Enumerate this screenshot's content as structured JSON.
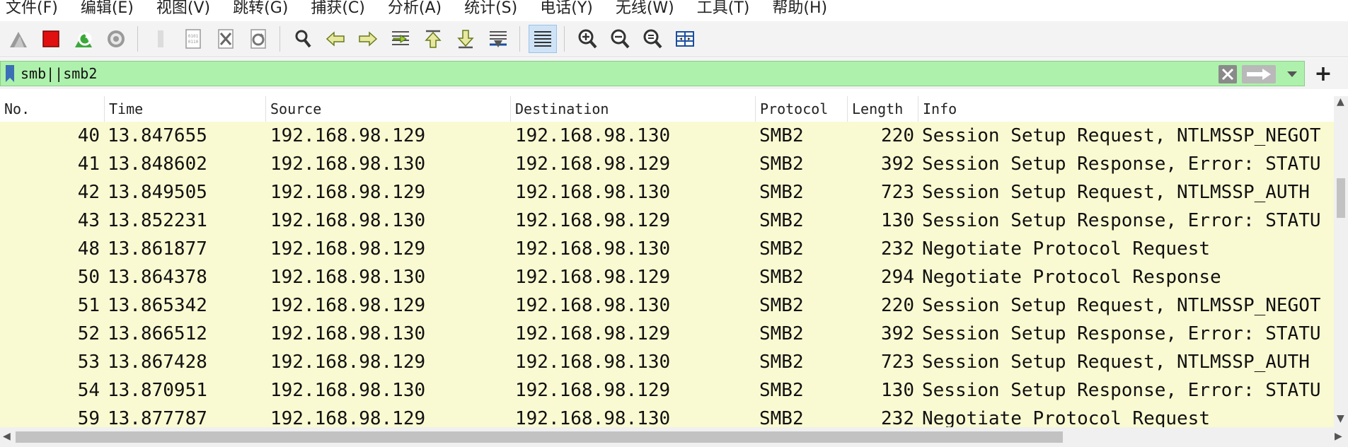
{
  "menu": [
    "文件(F)",
    "编辑(E)",
    "视图(V)",
    "跳转(G)",
    "捕获(C)",
    "分析(A)",
    "统计(S)",
    "电话(Y)",
    "无线(W)",
    "工具(T)",
    "帮助(H)"
  ],
  "toolbar_icons": [
    "shark-fin-start-icon",
    "stop-capture-icon",
    "restart-capture-icon",
    "capture-options-icon",
    "open-file-icon",
    "binary-file-icon",
    "close-file-icon",
    "reload-file-icon",
    "find-packet-icon",
    "go-back-icon",
    "go-forward-icon",
    "go-to-packet-icon",
    "first-packet-icon",
    "last-packet-icon",
    "autoscroll-icon",
    "colorize-icon",
    "zoom-in-icon",
    "zoom-out-icon",
    "normal-size-icon",
    "resize-columns-icon"
  ],
  "filter": {
    "text": "smb||smb2"
  },
  "columns": {
    "no": "No.",
    "time": "Time",
    "source": "Source",
    "destination": "Destination",
    "protocol": "Protocol",
    "length": "Length",
    "info": "Info"
  },
  "packets": [
    {
      "no": "40",
      "time": "13.847655",
      "source": "192.168.98.129",
      "destination": "192.168.98.130",
      "protocol": "SMB2",
      "length": "220",
      "info": "Session Setup Request, NTLMSSP_NEGOT"
    },
    {
      "no": "41",
      "time": "13.848602",
      "source": "192.168.98.130",
      "destination": "192.168.98.129",
      "protocol": "SMB2",
      "length": "392",
      "info": "Session Setup Response, Error: STATU"
    },
    {
      "no": "42",
      "time": "13.849505",
      "source": "192.168.98.129",
      "destination": "192.168.98.130",
      "protocol": "SMB2",
      "length": "723",
      "info": "Session Setup Request, NTLMSSP_AUTH"
    },
    {
      "no": "43",
      "time": "13.852231",
      "source": "192.168.98.130",
      "destination": "192.168.98.129",
      "protocol": "SMB2",
      "length": "130",
      "info": "Session Setup Response, Error: STATU"
    },
    {
      "no": "48",
      "time": "13.861877",
      "source": "192.168.98.129",
      "destination": "192.168.98.130",
      "protocol": "SMB2",
      "length": "232",
      "info": "Negotiate Protocol Request"
    },
    {
      "no": "50",
      "time": "13.864378",
      "source": "192.168.98.130",
      "destination": "192.168.98.129",
      "protocol": "SMB2",
      "length": "294",
      "info": "Negotiate Protocol Response"
    },
    {
      "no": "51",
      "time": "13.865342",
      "source": "192.168.98.129",
      "destination": "192.168.98.130",
      "protocol": "SMB2",
      "length": "220",
      "info": "Session Setup Request, NTLMSSP_NEGOT"
    },
    {
      "no": "52",
      "time": "13.866512",
      "source": "192.168.98.130",
      "destination": "192.168.98.129",
      "protocol": "SMB2",
      "length": "392",
      "info": "Session Setup Response, Error: STATU"
    },
    {
      "no": "53",
      "time": "13.867428",
      "source": "192.168.98.129",
      "destination": "192.168.98.130",
      "protocol": "SMB2",
      "length": "723",
      "info": "Session Setup Request, NTLMSSP_AUTH"
    },
    {
      "no": "54",
      "time": "13.870951",
      "source": "192.168.98.130",
      "destination": "192.168.98.129",
      "protocol": "SMB2",
      "length": "130",
      "info": "Session Setup Response, Error: STATU"
    },
    {
      "no": "59",
      "time": "13.877787",
      "source": "192.168.98.129",
      "destination": "192.168.98.130",
      "protocol": "SMB2",
      "length": "232",
      "info": "Negotiate Protocol Request"
    }
  ],
  "colors": {
    "row_background": "#fafad2",
    "filter_background": "#aef1ac",
    "toolbar_background": "#f3f3f3"
  }
}
